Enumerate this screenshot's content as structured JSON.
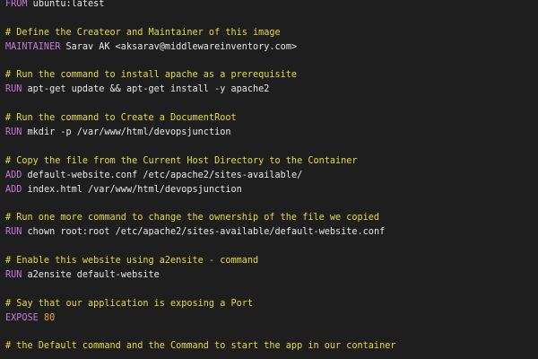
{
  "lines": [
    {
      "type": "instr",
      "keyword": "FROM",
      "args": " ubuntu:latest"
    },
    {
      "type": "blank"
    },
    {
      "type": "comment",
      "text": "# Define the Createor and Maintainer of this image"
    },
    {
      "type": "instr",
      "keyword": "MAINTAINER",
      "args": " Sarav AK <aksarav@middlewareinventory.com>"
    },
    {
      "type": "blank"
    },
    {
      "type": "comment",
      "text": "# Run the command to install apache as a prerequisite"
    },
    {
      "type": "instr",
      "keyword": "RUN",
      "args": " apt-get update && apt-get install -y apache2"
    },
    {
      "type": "blank"
    },
    {
      "type": "comment",
      "text": "# Run the command to Create a DocumentRoot"
    },
    {
      "type": "instr",
      "keyword": "RUN",
      "args": " mkdir -p /var/www/html/devopsjunction"
    },
    {
      "type": "blank"
    },
    {
      "type": "comment",
      "text": "# Copy the file from the Current Host Directory to the Container"
    },
    {
      "type": "instr",
      "keyword": "ADD",
      "args": " default-website.conf /etc/apache2/sites-available/"
    },
    {
      "type": "instr",
      "keyword": "ADD",
      "args": " index.html /var/www/html/devopsjunction"
    },
    {
      "type": "blank"
    },
    {
      "type": "comment",
      "text": "# Run one more command to change the ownership of the file we copied"
    },
    {
      "type": "instr",
      "keyword": "RUN",
      "args": " chown root:root /etc/apache2/sites-available/default-website.conf"
    },
    {
      "type": "blank"
    },
    {
      "type": "comment",
      "text": "# Enable this website using a2ensite - command"
    },
    {
      "type": "instr",
      "keyword": "RUN",
      "args": " a2ensite default-website"
    },
    {
      "type": "blank"
    },
    {
      "type": "comment",
      "text": "# Say that our application is exposing a Port"
    },
    {
      "type": "instr",
      "keyword": "EXPOSE",
      "args": " ",
      "number": "80"
    },
    {
      "type": "blank"
    },
    {
      "type": "comment",
      "text": "# the Default command and the Command to start the app in our container"
    }
  ],
  "colors": {
    "background": "#1e1e1e",
    "keyword": "#c479d8",
    "comment": "#e6dc3c",
    "text": "#e8e8e8",
    "number": "#f0a040"
  }
}
